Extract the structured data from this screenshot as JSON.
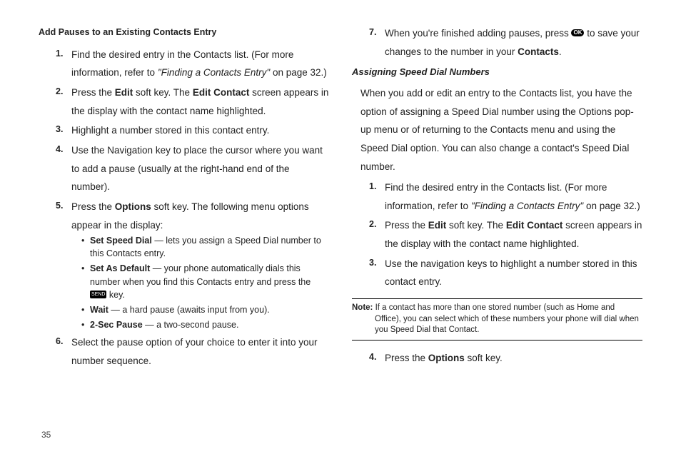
{
  "left": {
    "heading": "Add Pauses to an Existing Contacts Entry",
    "steps": {
      "s1a": "Find the desired entry in the Contacts list. (For more information, refer to ",
      "s1b": "\"Finding a Contacts Entry\"",
      "s1c": "  on page 32.)",
      "s2a": "Press the ",
      "s2b": "Edit",
      "s2c": " soft key. The ",
      "s2d": "Edit Contact",
      "s2e": " screen appears in the display with the contact name highlighted.",
      "s3": "Highlight a number stored in this contact entry.",
      "s4": "Use the Navigation key to place the cursor where you want to add a pause (usually at the right-hand end of the number).",
      "s5a": "Press the ",
      "s5b": "Options",
      "s5c": " soft key. The following menu options appear in the display:",
      "b1a": "Set Speed Dial",
      "b1b": " — lets you assign a Speed Dial number to this Contacts entry.",
      "b2a": "Set As Default",
      "b2b": " — your phone automatically dials this number when you find this Contacts entry and press the ",
      "b2c": " key.",
      "b3a": "Wait",
      "b3b": " — a hard pause (awaits input from you).",
      "b4a": "2-Sec Pause",
      "b4b": " — a two-second pause.",
      "s6": "Select the pause option of your choice to enter it into your number sequence."
    }
  },
  "right": {
    "s7a": "When you're finished adding pauses, press ",
    "s7b": " to save your changes to the number in your ",
    "s7c": "Contacts",
    "s7d": ".",
    "subheading": "Assigning Speed Dial Numbers",
    "intro": "When you add or edit an entry to the Contacts list, you have the option of assigning a Speed Dial number using the Options pop-up menu or of returning to the Contacts menu and using the Speed Dial option. You can also change a contact's Speed Dial number.",
    "s1a": "Find the desired entry in the Contacts list. (For more information, refer to ",
    "s1b": "\"Finding a Contacts Entry\"",
    "s1c": "  on page 32.)",
    "s2a": "Press the ",
    "s2b": "Edit",
    "s2c": " soft key. The ",
    "s2d": "Edit Contact",
    "s2e": " screen appears in the display with the contact name highlighted.",
    "s3": "Use the navigation keys to highlight a number stored in this contact entry.",
    "noteLabel": "Note:",
    "noteBody": " If a contact has more than one stored number (such as Home and Office), you can select which of these numbers your phone will dial when you Speed Dial that Contact.",
    "s4a": "Press the ",
    "s4b": "Options",
    "s4c": " soft key."
  },
  "okLabel": "OK",
  "sendLabel": "SEND",
  "pageNum": "35"
}
